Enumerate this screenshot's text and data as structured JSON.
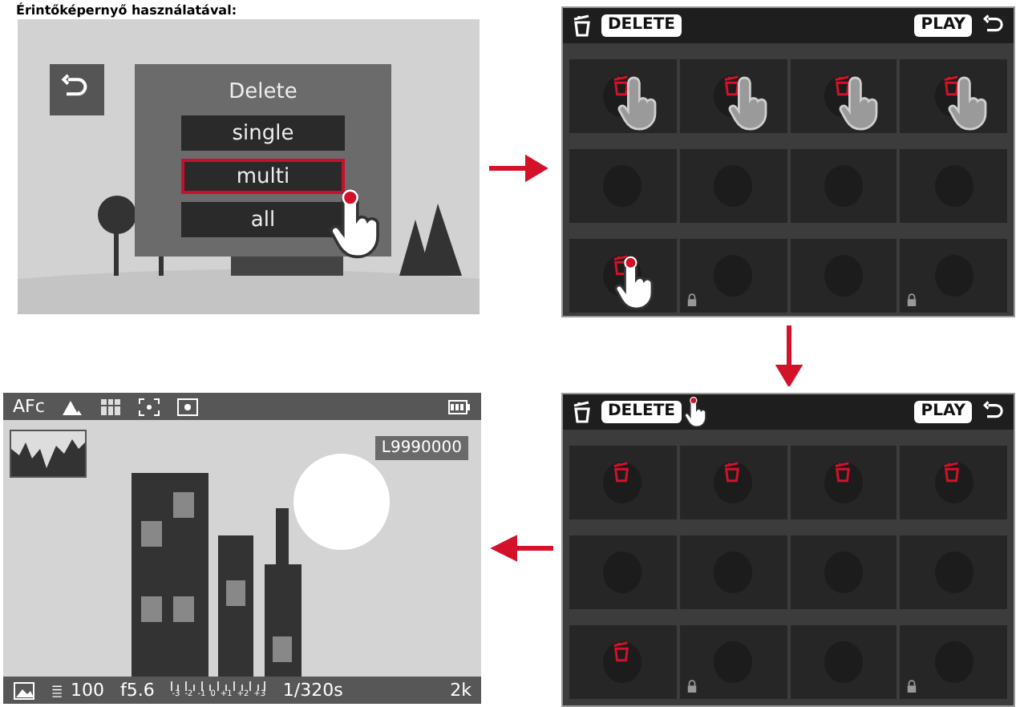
{
  "heading": "Érintőképernyő használatával:",
  "menu_screen": {
    "title": "Delete",
    "options": [
      {
        "label": "single",
        "selected": false
      },
      {
        "label": "multi",
        "selected": true
      },
      {
        "label": "all",
        "selected": false
      }
    ]
  },
  "selection_screen": {
    "delete_label": "DELETE",
    "play_label": "PLAY",
    "delete_touched": false,
    "tiles": [
      {
        "marked": true,
        "locked": false,
        "touched": true,
        "tapping": false
      },
      {
        "marked": true,
        "locked": false,
        "touched": true,
        "tapping": false
      },
      {
        "marked": true,
        "locked": false,
        "touched": true,
        "tapping": false
      },
      {
        "marked": true,
        "locked": false,
        "touched": true,
        "tapping": false
      },
      {
        "marked": false,
        "locked": false,
        "touched": false,
        "tapping": false
      },
      {
        "marked": false,
        "locked": false,
        "touched": false,
        "tapping": false
      },
      {
        "marked": false,
        "locked": false,
        "touched": false,
        "tapping": false
      },
      {
        "marked": false,
        "locked": false,
        "touched": false,
        "tapping": false
      },
      {
        "marked": true,
        "locked": false,
        "touched": false,
        "tapping": true
      },
      {
        "marked": false,
        "locked": true,
        "touched": false,
        "tapping": false
      },
      {
        "marked": false,
        "locked": false,
        "touched": false,
        "tapping": false
      },
      {
        "marked": false,
        "locked": true,
        "touched": false,
        "tapping": false
      }
    ]
  },
  "confirm_screen": {
    "delete_label": "DELETE",
    "play_label": "PLAY",
    "delete_touched": true,
    "tiles": [
      {
        "marked": true,
        "locked": false,
        "touched": false,
        "tapping": false
      },
      {
        "marked": true,
        "locked": false,
        "touched": false,
        "tapping": false
      },
      {
        "marked": true,
        "locked": false,
        "touched": false,
        "tapping": false
      },
      {
        "marked": true,
        "locked": false,
        "touched": false,
        "tapping": false
      },
      {
        "marked": false,
        "locked": false,
        "touched": false,
        "tapping": false
      },
      {
        "marked": false,
        "locked": false,
        "touched": false,
        "tapping": false
      },
      {
        "marked": false,
        "locked": false,
        "touched": false,
        "tapping": false
      },
      {
        "marked": false,
        "locked": false,
        "touched": false,
        "tapping": false
      },
      {
        "marked": true,
        "locked": false,
        "touched": false,
        "tapping": false
      },
      {
        "marked": false,
        "locked": true,
        "touched": false,
        "tapping": false
      },
      {
        "marked": false,
        "locked": false,
        "touched": false,
        "tapping": false
      },
      {
        "marked": false,
        "locked": true,
        "touched": false,
        "tapping": false
      }
    ]
  },
  "live_view": {
    "af_mode": "AFc",
    "exposure_counter": "L9990000",
    "iso": "100",
    "aperture": "f5.6",
    "scale_labels": [
      "-3",
      "-2",
      "-1",
      "0",
      "+1",
      "+2",
      "+3"
    ],
    "shutter": "1/320s",
    "resolution": "2k"
  }
}
